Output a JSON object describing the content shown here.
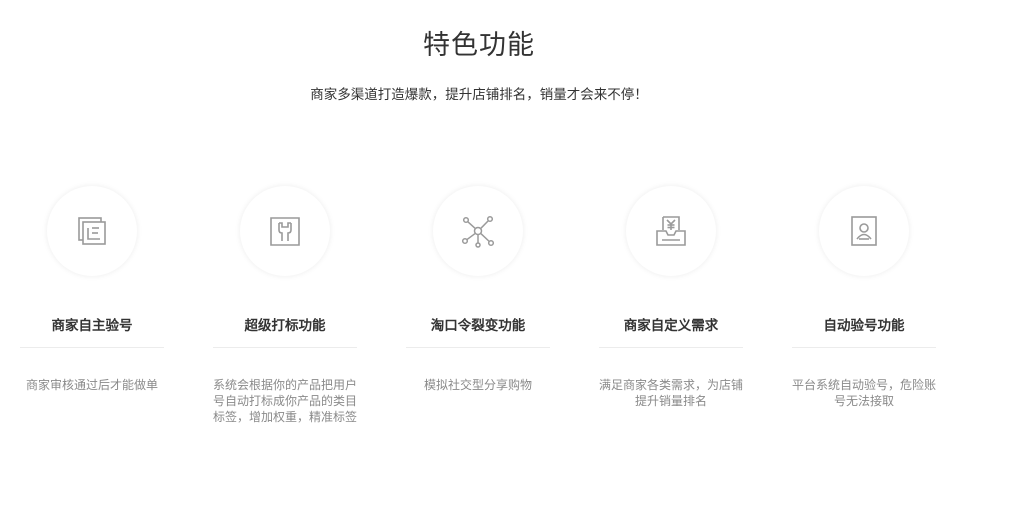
{
  "header": {
    "title": "特色功能",
    "subtitle": "商家多渠道打造爆款，提升店铺排名，销量才会来不停！"
  },
  "features": [
    {
      "icon": "document-stack-icon",
      "title": "商家自主验号",
      "description": "商家审核通过后才能做单"
    },
    {
      "icon": "wrench-tag-icon",
      "title": "超级打标功能",
      "description": "系统会根据你的产品把用户号自动打标成你产品的类目标签，增加权重，精准标签"
    },
    {
      "icon": "network-nodes-icon",
      "title": "淘口令裂变功能",
      "description": "模拟社交型分享购物"
    },
    {
      "icon": "yen-inbox-icon",
      "title": "商家自定义需求",
      "description": "满足商家各类需求，为店铺提升销量排名"
    },
    {
      "icon": "user-id-card-icon",
      "title": "自动验号功能",
      "description": "平台系统自动验号，危险账号无法接取"
    }
  ],
  "colors": {
    "title_text": "#333333",
    "desc_text": "#8a8a8a",
    "icon_stroke": "#9a9a9a",
    "divider": "#ececec"
  }
}
